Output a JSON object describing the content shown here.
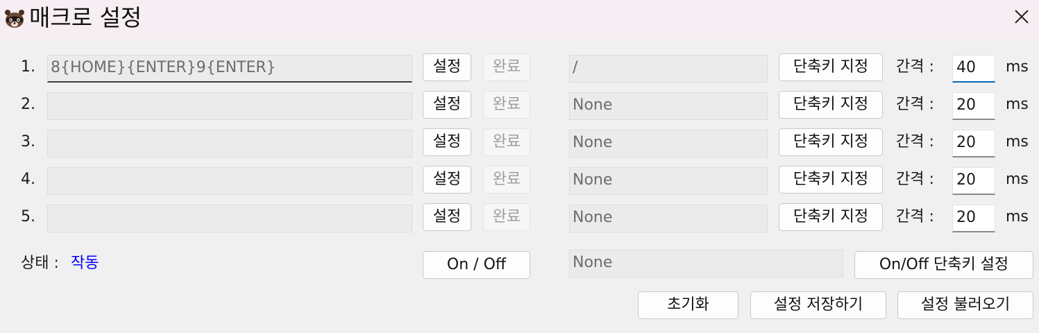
{
  "window": {
    "title": "매크로 설정",
    "icon": "raccoon-app-icon",
    "close": "close-icon"
  },
  "rows": [
    {
      "num": "1.",
      "macro": "8{HOME}{ENTER}9{ENTER}",
      "set_label": "설정",
      "done_label": "완료",
      "hotkey": "/",
      "hotkey_btn": "단축키 지정",
      "gap_label": "간격 :",
      "interval": "40",
      "unit": "ms"
    },
    {
      "num": "2.",
      "macro": "",
      "set_label": "설정",
      "done_label": "완료",
      "hotkey": "None",
      "hotkey_btn": "단축키 지정",
      "gap_label": "간격 :",
      "interval": "20",
      "unit": "ms"
    },
    {
      "num": "3.",
      "macro": "",
      "set_label": "설정",
      "done_label": "완료",
      "hotkey": "None",
      "hotkey_btn": "단축키 지정",
      "gap_label": "간격 :",
      "interval": "20",
      "unit": "ms"
    },
    {
      "num": "4.",
      "macro": "",
      "set_label": "설정",
      "done_label": "완료",
      "hotkey": "None",
      "hotkey_btn": "단축키 지정",
      "gap_label": "간격 :",
      "interval": "20",
      "unit": "ms"
    },
    {
      "num": "5.",
      "macro": "",
      "set_label": "설정",
      "done_label": "완료",
      "hotkey": "None",
      "hotkey_btn": "단축키 지정",
      "gap_label": "간격 :",
      "interval": "20",
      "unit": "ms"
    }
  ],
  "status": {
    "label": "상태 :",
    "value": "작동",
    "value_color": "#0000ff",
    "onoff_btn": "On / Off",
    "onoff_hotkey": "None",
    "onoff_hotkey_btn": "On/Off 단축키 설정"
  },
  "footer": {
    "reset": "초기화",
    "save": "설정 저장하기",
    "load": "설정 불러오기"
  },
  "colors": {
    "titlebar_bg": "#f7eef3",
    "window_bg": "#f0f0f0",
    "focus_accent": "#0067c0"
  }
}
